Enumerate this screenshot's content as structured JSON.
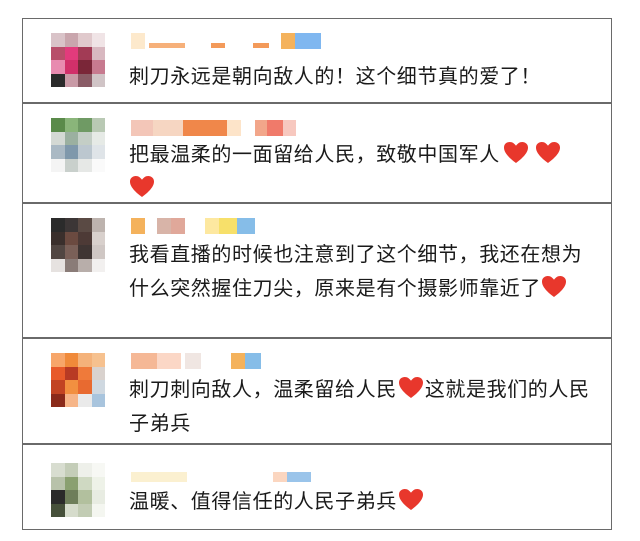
{
  "comments": [
    {
      "text": "刺刀永远是朝向敌人的！这个细节真的爱了！",
      "hearts": 0
    },
    {
      "text": "把最温柔的一面留给人民，致敬中国军人",
      "hearts": 3
    },
    {
      "text": "我看直播的时候也注意到了这个细节，我还在想为什么突然握住刀尖，原来是有个摄影师靠近了",
      "hearts": 1
    },
    {
      "text": "刺刀刺向敌人，温柔留给人民",
      "text_after": "这就是我们的人民子弟兵",
      "hearts_inline": 1
    },
    {
      "text": "温暖、值得信任的人民子弟兵",
      "hearts": 1
    }
  ],
  "colors": {
    "heart": "#e8372c",
    "border": "#6a6a6a",
    "text": "#1a1a1a"
  }
}
